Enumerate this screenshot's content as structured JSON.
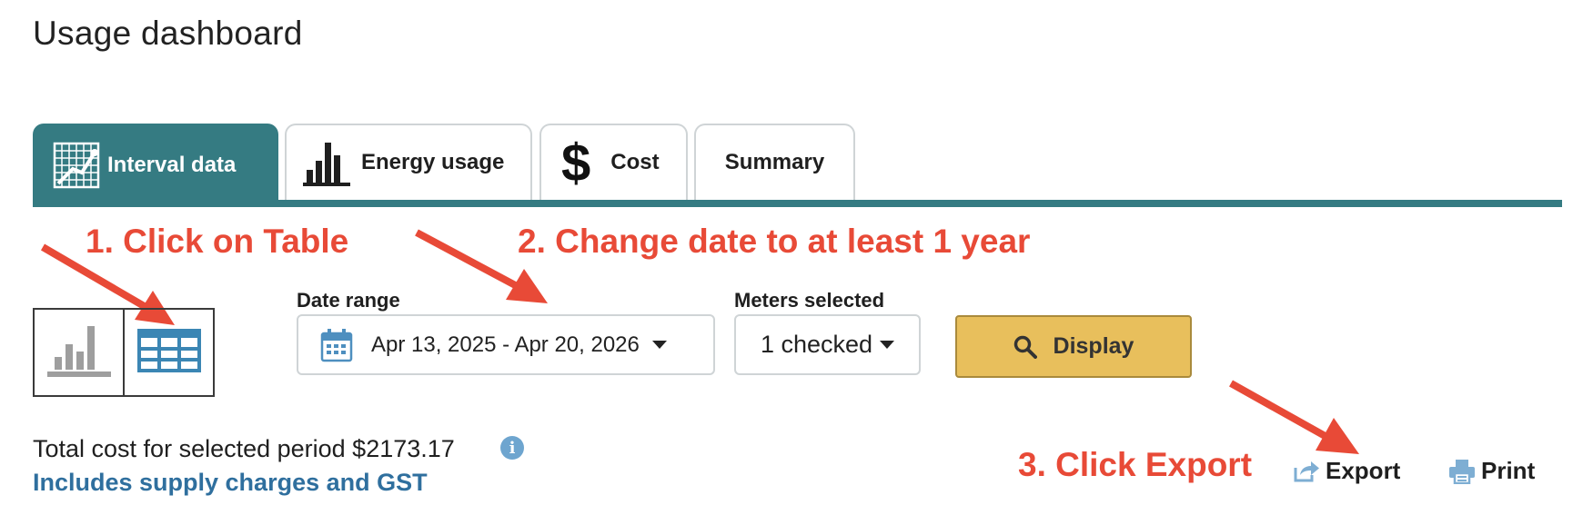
{
  "page": {
    "title": "Usage dashboard"
  },
  "tabs": [
    {
      "label": "Interval data",
      "icon": "interval-chart-icon",
      "active": true
    },
    {
      "label": "Energy usage",
      "icon": "bar-chart-icon",
      "active": false
    },
    {
      "label": "Cost",
      "icon": "dollar-icon",
      "active": false
    },
    {
      "label": "Summary",
      "icon": "",
      "active": false
    }
  ],
  "annotations": {
    "step1": "1. Click on Table",
    "step2": "2. Change date to at least 1 year",
    "step3": "3. Click Export",
    "color": "#e84a37"
  },
  "view_toggle": {
    "chart_icon": "bar-chart-view-icon",
    "table_icon": "table-view-icon",
    "selected": "table"
  },
  "date_range": {
    "label": "Date range",
    "value": "Apr 13, 2025 - Apr 20, 2026",
    "icon": "calendar-icon"
  },
  "meters": {
    "label": "Meters selected",
    "value": "1 checked"
  },
  "display_button": {
    "label": "Display",
    "icon": "search-icon"
  },
  "summary": {
    "total_cost_text": "Total cost for selected period $2173.17",
    "supply_note": "Includes supply charges and GST",
    "info_icon": "i"
  },
  "actions": {
    "export_label": "Export",
    "print_label": "Print"
  },
  "colors": {
    "teal": "#357b82",
    "accent_yellow": "#e8bf5c",
    "link_blue": "#2f6f9e",
    "annotation_red": "#e84a37"
  }
}
